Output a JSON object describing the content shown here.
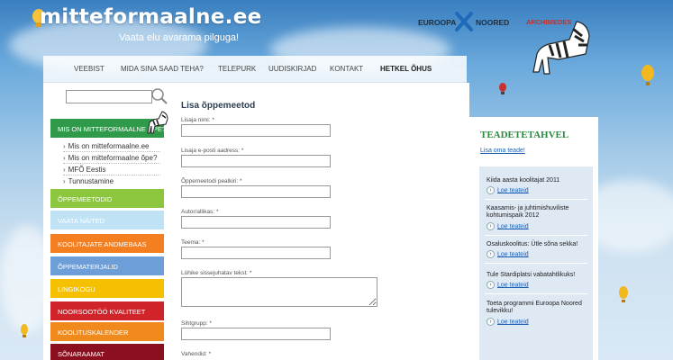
{
  "header": {
    "logo": "mitteformaalne.ee",
    "tagline": "Vaata elu avarama pilguga!",
    "partner": {
      "part1": "EUROOPA",
      "part2": "NOORED",
      "part3": "ARCHIMEDES"
    }
  },
  "nav": {
    "items": [
      "VEEBIST",
      "MIDA SINA SAAD TEHA?",
      "TELEPURK",
      "UUDISKIRJAD",
      "KONTAKT",
      "HETKEL ÕHUS"
    ]
  },
  "sidebar": {
    "search_value": "",
    "menu": [
      {
        "label": "MIS ON MITTEFORMAALNE ÕPE?",
        "color": "#2e9a4a"
      },
      {
        "label": "ÕPPEMEETODID",
        "color": "#8cc63e"
      },
      {
        "label": "VAATA NÄITED",
        "color": "#bfe3f5"
      },
      {
        "label": "KOOLITAJATE ANDMEBAAS",
        "color": "#f47f20"
      },
      {
        "label": "ÕPPEMATERJALID",
        "color": "#6d9ed8"
      },
      {
        "label": "LINGIKOGU",
        "color": "#f5c000"
      },
      {
        "label": "NOORSOOTÖÖ KVALITEET",
        "color": "#d0232a"
      },
      {
        "label": "KOOLITUSKALENDER",
        "color": "#f08a1d"
      },
      {
        "label": "SÕNARAAMAT",
        "color": "#8a1020"
      }
    ],
    "submenu": [
      "Mis on mitteformaalne.ee",
      "Mis on mitteformaalne õpe?",
      "MFÕ Eestis",
      "Tunnustamine"
    ]
  },
  "form": {
    "title": "Lisa õppemeetod",
    "fields": [
      {
        "label": "Lisaja nimi: *",
        "value": ""
      },
      {
        "label": "Lisaja e-posti aadress: *",
        "value": ""
      },
      {
        "label": "Õppemeetodi pealkiri: *",
        "value": ""
      },
      {
        "label": "Autor/allikas: *",
        "value": ""
      },
      {
        "label": "Teema: *",
        "value": ""
      },
      {
        "label": "Lühike sissejuhatav tekst: *",
        "value": ""
      },
      {
        "label": "Sihtgrupp: *",
        "value": ""
      },
      {
        "label": "Vahendid: *",
        "value": ""
      }
    ]
  },
  "board": {
    "title": "TEADETETAHVEL",
    "add_link": "Lisa oma teade!",
    "read_label": "Loe teateid",
    "items": [
      "Kiida aasta koolitajat 2011",
      "Kaasamis- ja juhtimishuviliste kohtumispaik 2012",
      "Osaluskoolitus: Ütle sõna sekka!",
      "Tule Stardiplatsi vabatahtlikuks!",
      "Toeta programmi Euroopa Noored tulevikku!"
    ]
  },
  "colors": {
    "sky": "#6aa9dc",
    "board_title": "#2a8a3e",
    "link": "#1a5fb4"
  }
}
